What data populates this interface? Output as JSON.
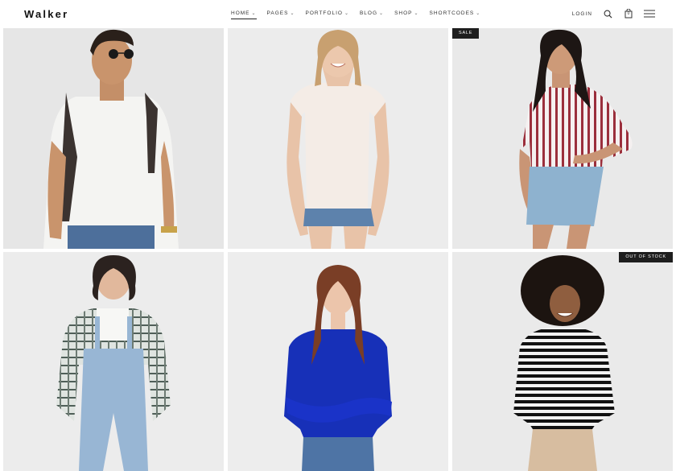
{
  "header": {
    "logo": "Walker",
    "nav": [
      {
        "label": "HOME",
        "active": true
      },
      {
        "label": "PAGES",
        "active": false
      },
      {
        "label": "PORTFOLIO",
        "active": false
      },
      {
        "label": "BLOG",
        "active": false
      },
      {
        "label": "SHOP",
        "active": false
      },
      {
        "label": "SHORTCODES",
        "active": false
      }
    ],
    "login": "LOGIN",
    "cart_count": "0"
  },
  "products": [
    {
      "badge": ""
    },
    {
      "badge": ""
    },
    {
      "badge": "SALE"
    },
    {
      "badge": ""
    },
    {
      "badge": ""
    },
    {
      "badge": "OUT OF STOCK"
    }
  ],
  "colors": {
    "card_bg": "#ebebeb",
    "badge_bg": "#1e1e1e",
    "text": "#222222"
  }
}
